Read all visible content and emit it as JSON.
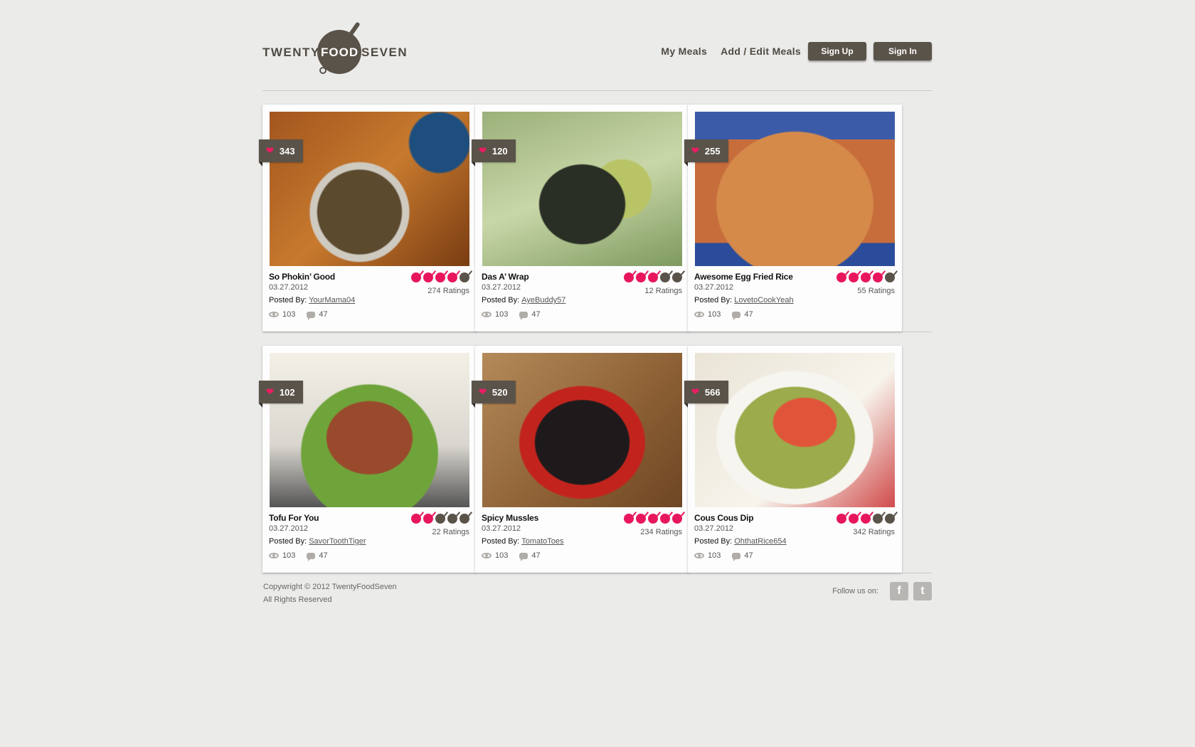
{
  "brand": {
    "left": "TWENTY",
    "middle": "FOOD",
    "right": "SEVEN"
  },
  "nav": {
    "links": [
      "My Meals",
      "Add / Edit Meals"
    ],
    "buttons": [
      "Sign Up",
      "Sign In"
    ]
  },
  "meals": [
    {
      "likes": "343",
      "title": "So Phokin’ Good",
      "date": "03.27.2012",
      "posted_label": "Posted By:",
      "user": "YourMama04",
      "views": "103",
      "comments": "47",
      "rating": 4,
      "ratings_label": "274 Ratings"
    },
    {
      "likes": "120",
      "title": "Das A’ Wrap",
      "date": "03.27.2012",
      "posted_label": "Posted By:",
      "user": "AyeBuddy57",
      "views": "103",
      "comments": "47",
      "rating": 3,
      "ratings_label": "12 Ratings"
    },
    {
      "likes": "255",
      "title": "Awesome Egg Fried Rice",
      "date": "03.27.2012",
      "posted_label": "Posted By:",
      "user": "LovetoCookYeah",
      "views": "103",
      "comments": "47",
      "rating": 4,
      "ratings_label": "55 Ratings"
    },
    {
      "likes": "102",
      "title": "Tofu For You",
      "date": "03.27.2012",
      "posted_label": "Posted By:",
      "user": "SavorToothTiger",
      "views": "103",
      "comments": "47",
      "rating": 2,
      "ratings_label": "22 Ratings"
    },
    {
      "likes": "520",
      "title": "Spicy Mussles",
      "date": "03.27.2012",
      "posted_label": "Posted By:",
      "user": "TomatoToes",
      "views": "103",
      "comments": "47",
      "rating": 5,
      "ratings_label": "234 Ratings"
    },
    {
      "likes": "566",
      "title": "Cous Cous Dip",
      "date": "03.27.2012",
      "posted_label": "Posted By:",
      "user": "OhthatRice654",
      "views": "103",
      "comments": "47",
      "rating": 3,
      "ratings_label": "342 Ratings"
    }
  ],
  "footer": {
    "copyright": "Copywright © 2012 TwentyFoodSeven",
    "rights": "All Rights Reserved",
    "follow_label": "Follow us on:",
    "social": [
      "facebook-icon",
      "twitter-icon"
    ]
  },
  "colors": {
    "accent": "#e8175d",
    "brand": "#5a534a",
    "background": "#ebebea"
  }
}
